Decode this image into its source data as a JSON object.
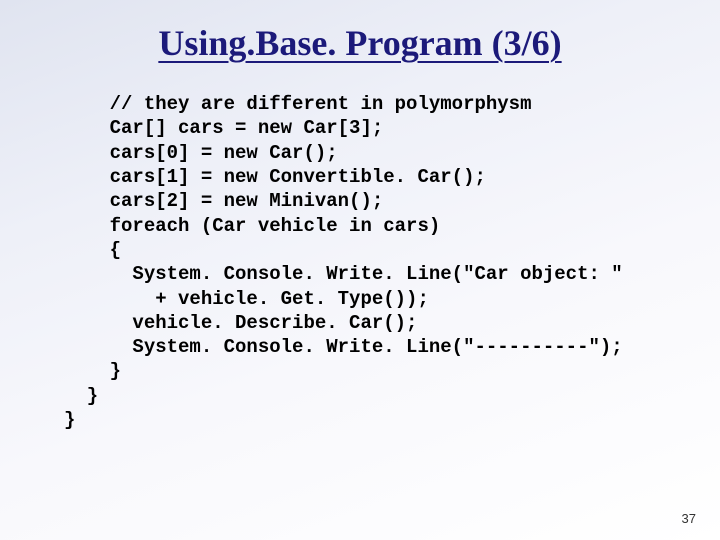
{
  "title": "Using.Base. Program (3/6)",
  "code": "    // they are different in polymorphysm\n    Car[] cars = new Car[3];\n    cars[0] = new Car();\n    cars[1] = new Convertible. Car();\n    cars[2] = new Minivan();\n    foreach (Car vehicle in cars)\n    {\n      System. Console. Write. Line(\"Car object: \"\n        + vehicle. Get. Type());\n      vehicle. Describe. Car();\n      System. Console. Write. Line(\"----------\");\n    }\n  }\n}",
  "page_number": "37"
}
